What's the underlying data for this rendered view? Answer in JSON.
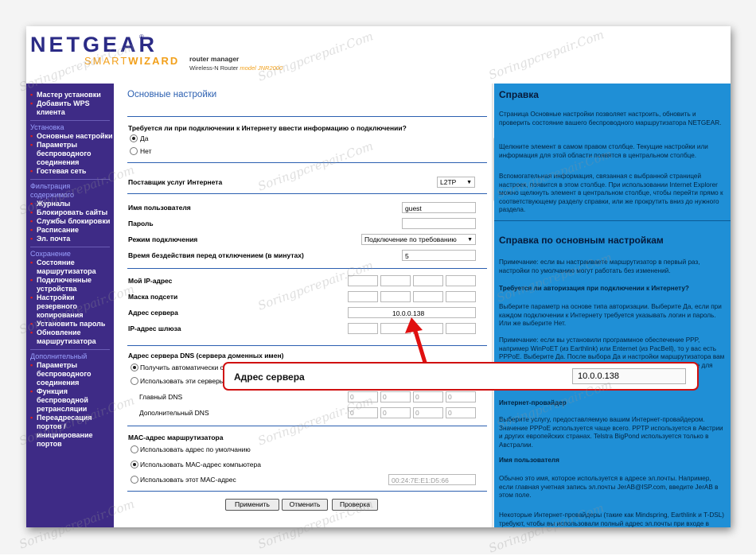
{
  "header": {
    "logo_main": "NETGEAR",
    "logo_reg": "®",
    "logo_smart": "SMART",
    "logo_wizard": "WIZARD",
    "product_title": "router manager",
    "product_sub": "Wireless-N Router",
    "model": "model JNR2000"
  },
  "nav": {
    "top_items": [
      "Мастер установки",
      "Добавить WPS клиента"
    ],
    "setup_head": "Установка",
    "setup_items": [
      "Основные настройки",
      "Параметры беспроводного соединения",
      "Гостевая сеть"
    ],
    "filter_head": "Фильтрация содержимого",
    "filter_items": [
      "Журналы",
      "Блокировать сайты",
      "Службы блокировки",
      "Расписание",
      "Эл. почта"
    ],
    "maint_head": "Сохранение",
    "maint_items": [
      "Состояние маршрутизатора",
      "Подключенные устройства",
      "Настройки резервного копирования",
      "Установить пароль",
      "Обновление маршрутизатора"
    ],
    "adv_head": "Дополнительный",
    "adv_items": [
      "Параметры беспроводного соединения",
      "Функция беспроводной ретрансляции",
      "Переадресация портов / инициирование портов"
    ]
  },
  "content": {
    "title": "Основные настройки",
    "q_login": "Требуется ли при подключении к Интернету ввести информацию о подключении?",
    "yes": "Да",
    "no": "Нет",
    "isp_label": "Поставщик услуг Интернета",
    "isp_value": "L2TP",
    "user_label": "Имя пользователя",
    "user_value": "guest",
    "pass_label": "Пароль",
    "mode_label": "Режим подключения",
    "mode_value": "Подключение по требованию",
    "idle_label": "Время бездействия перед отключением (в минутах)",
    "idle_value": "5",
    "myip_label": "Мой IP-адрес",
    "mask_label": "Маска подсети",
    "server_label": "Адрес сервера",
    "server_value": "10.0.0.138",
    "gw_label": "IP-адрес шлюза",
    "dns_head": "Адрес сервера DNS (сервера доменных имен)",
    "dns_auto": "Получить автоматически от поставщика",
    "dns_manual": "Использовать эти серверы DNS",
    "dns_primary": "Главный DNS",
    "dns_secondary": "Дополнительный DNS",
    "zero": "0",
    "mac_head": "МАС-адрес маршрутизатора",
    "mac_default": "Использовать адрес по умолчанию",
    "mac_pc": "Использовать МАС-адрес компьютера",
    "mac_this": "Использовать этот МАС-адрес",
    "mac_value": "00:24:7E:E1:D5:66",
    "btn_apply": "Применить",
    "btn_cancel": "Отменить",
    "btn_test": "Проверка"
  },
  "help": {
    "title": "Справка",
    "p1": "Страница Основные настройки позволяет настроить, обновить и проверить состояние вашего беспроводного маршрутизатора NETGEAR.",
    "p2": "Щелкните элемент в самом правом столбце. Текущие настройки или информация для этой области появятся в центральном столбце.",
    "p3": "Вспомогательная информация, связанная с выбранной страницей настроек, появится в этом столбце. При использовании Internet Explorer можно щелкнуть элемент в центральном столбце, чтобы перейти прямо к соответствующему разделу справки, или же прокрутить вниз до нужного раздела.",
    "title2": "Справка по основным настройкам",
    "p4": "Примечание: если вы настраиваете маршрутизатор в первый раз, настройки по умолчанию могут работать без изменений.",
    "h_auth": "Требуется ли авторизация при подключении к Интернету?",
    "p5": "Выберите параметр на основе типа авторизации. Выберите Да, если при каждом подключении к Интернету требуется указывать логин и пароль. Или же выберите Нет.",
    "p6": "Примечание: если вы установили программное обеспечение PPP, например WinPoET (из Earthlink) или Enternet (из PacBell), то у вас есть PPPoE. Выберите Да. После выбора Да и настройки маршрутизатора вам больше не понадобится запускать программу PPP на компьютере для подключения к Интернету.",
    "h_isp": "Интернет-провайдер",
    "p7": "Выберите услугу, предоставляемую вашим Интернет-провайдером. Значение PPPoE используется чаще всего. PPTP используется в Австрии и других европейских странах. Telstra BigPond используется только в Австралии.",
    "h_user": "Имя пользователя",
    "p8": "Обычно это имя, которое используется в адресе эл.почты. Например, если главная учетная запись эл.почты JerAB@ISP.com, введите JerAB в этом поле.",
    "p9": "Некоторые Интернет-провайдеры (такие как Mindspring, Earthlink и T-DSL) требуют, чтобы вы использовали полный адрес эл.почты при входе в систему."
  },
  "callout": {
    "label": "Адрес сервера",
    "value": "10.0.0.138"
  },
  "watermark": "Soringpcrepair.Com",
  "colors": {
    "nav_bg": "#3e2b86",
    "help_bg": "#1f8fd6",
    "title_blue": "#2b5fb0",
    "callout_border": "#d01010",
    "arrow": "#e01010",
    "logo_orange": "#f2a01b"
  }
}
